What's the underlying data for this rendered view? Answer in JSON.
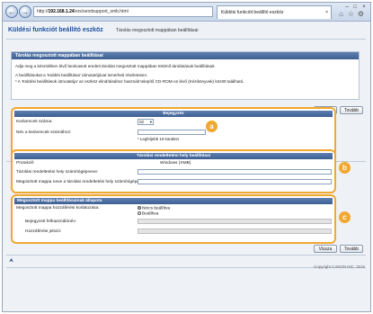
{
  "browser": {
    "url_prefix": "http://",
    "url_host": "192.168.1.24",
    "url_path": "/srs/sendsupport_smb.html",
    "tab_title": "Küldési funkciót beállító eszköz",
    "back_icon": "back-arrow-icon",
    "forward_icon": "forward-arrow-icon"
  },
  "header": {
    "app_title": "Küldési funkciót beállító eszköz",
    "page_title": "Tárolás megosztott mappában beállításai"
  },
  "intro": {
    "heading": "Tárolás megosztott mappában beállításai",
    "line1": "Adja meg a készüléken lévő beolvasott eredeti tárolási megosztott mappában történő tárolásának beállításait.",
    "line2": "A beállításokat a 'Küldés beállításai' útmutatójával ismerheti részletesen.",
    "line3": "* A 'Küldési beállítások útmutatója' az eszköz elindításához használt telepítő CD-ROM-on lévő (Kézikönyvek) között található."
  },
  "buttons": {
    "back": "Vissza",
    "next": "Tovább"
  },
  "section_a": {
    "badge": "a",
    "heading": "Bejegyzés",
    "favorite_label": "Kedvencek száma:",
    "favorite_value": "02",
    "name_label": "Név a kedvencek számához:",
    "name_hint": "* Legfeljebb 16 karakter"
  },
  "section_b": {
    "badge": "b",
    "heading": "Tárolási rendeltetési hely beállításai",
    "protocol_label": "Protokoll:",
    "protocol_value": "Windows (SMB)",
    "host_label": "Tárolási rendeltetési hely számítógépneve:",
    "path_label": "Megosztott mappa neve a tárolási rendeltetési hely számítógépen:"
  },
  "section_c": {
    "badge": "c",
    "heading": "Megosztott mappa beállításainak állapota",
    "access_label": "Megosztott mappa hozzáférési korlátozása:",
    "option_off": "Nincs beállítva",
    "option_on": "Beállítva",
    "user_label": "Bejegyzett felhasználónév:",
    "password_label": "Hozzáférési jelszó:"
  },
  "footer": {
    "copyright": "Copyright CANON INC. 2015"
  },
  "colors": {
    "accent_orange": "#f0a830",
    "header_blue": "#3e5f93",
    "title_blue": "#1d4fa0"
  }
}
